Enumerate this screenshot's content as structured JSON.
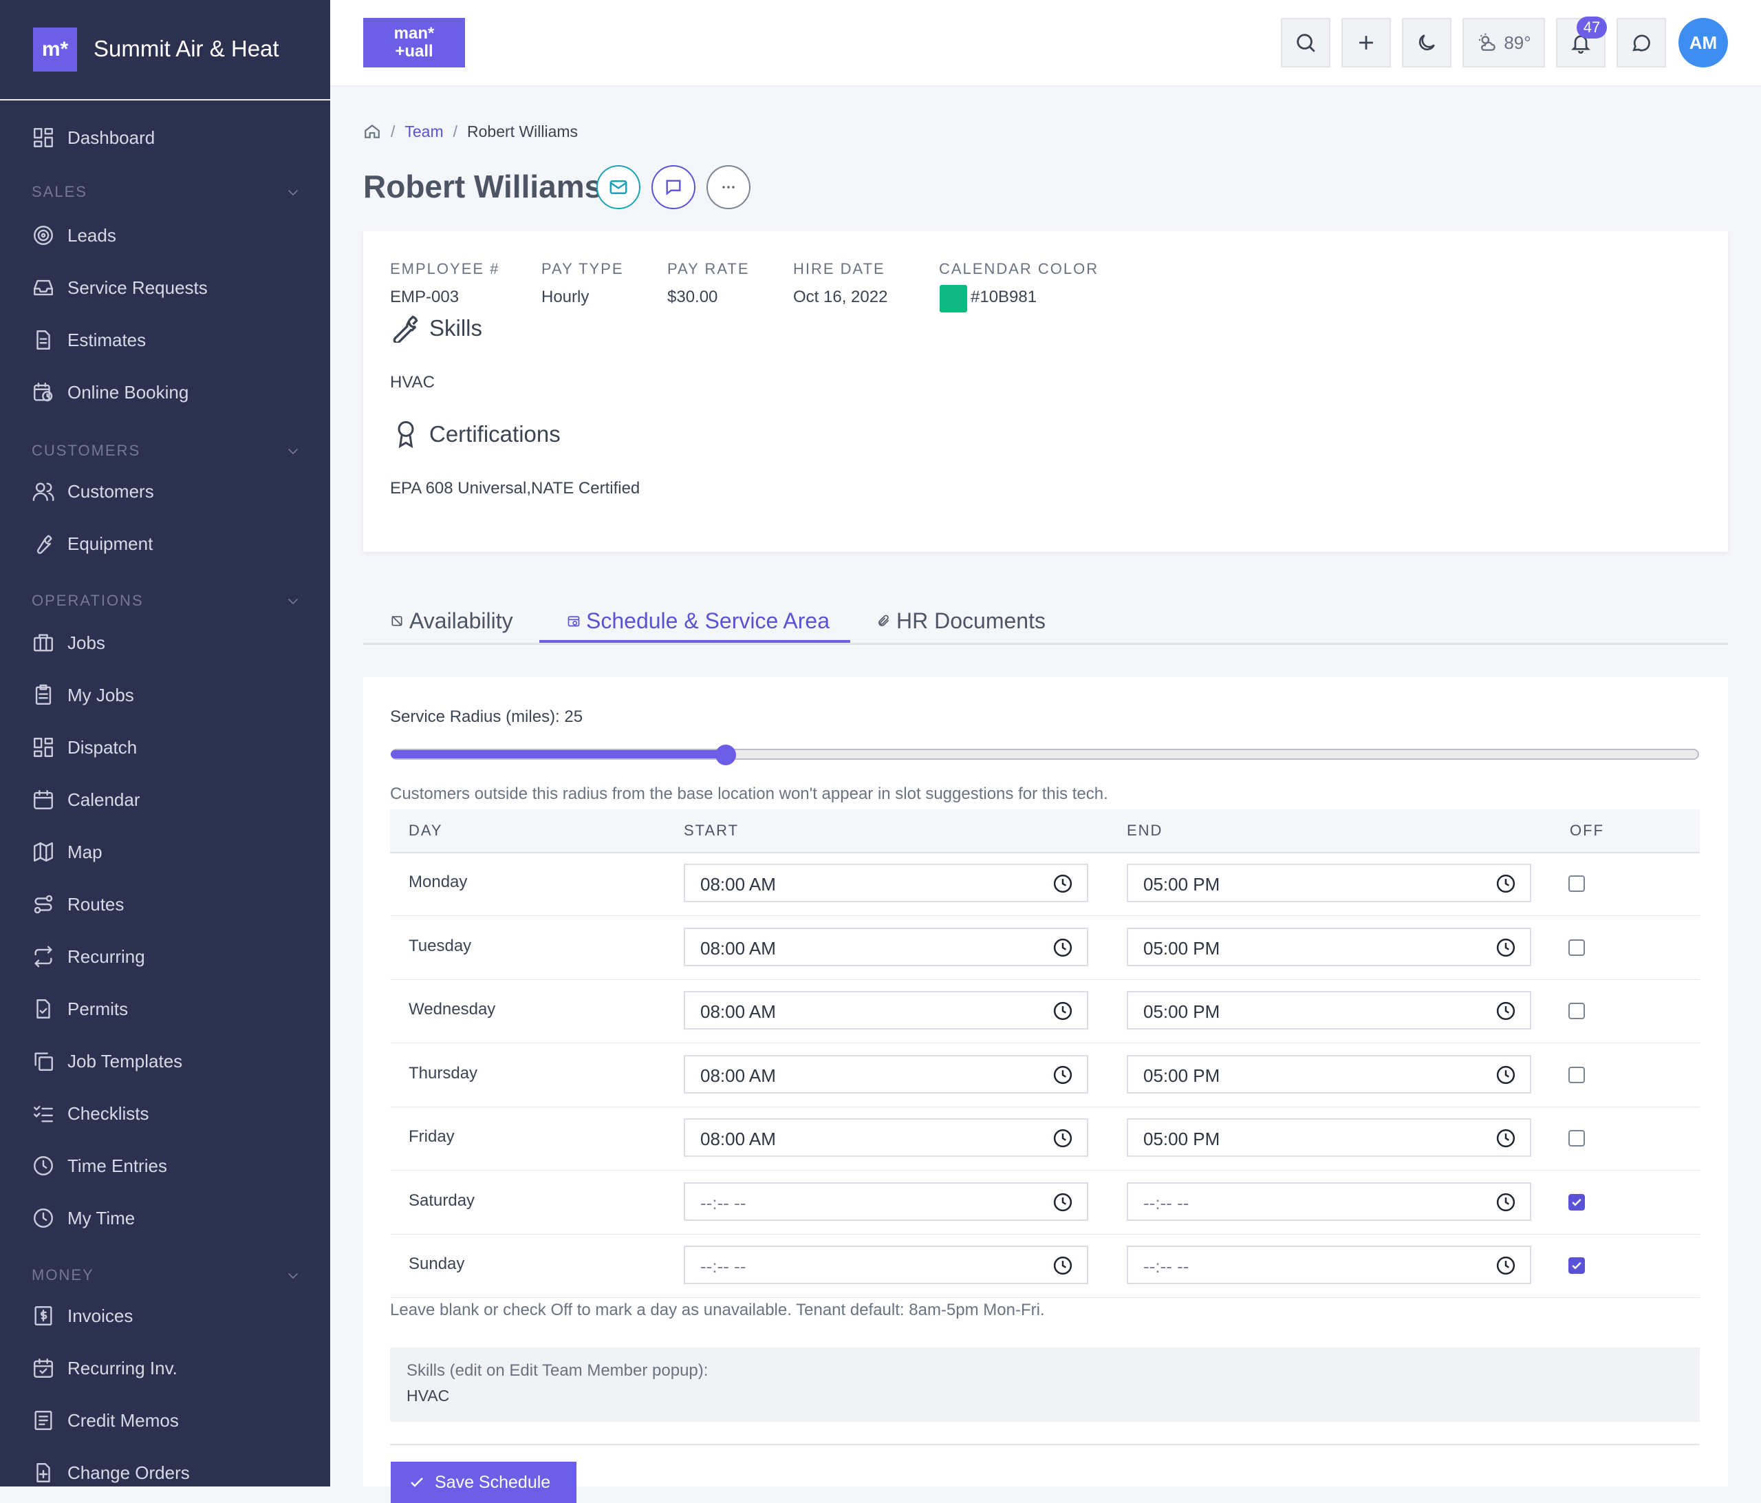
{
  "brand": {
    "logo_text": "m*",
    "name": "Summit Air & Heat"
  },
  "sidebar": {
    "items": [
      {
        "type": "item",
        "label": "Dashboard",
        "icon": "grid-icon"
      },
      {
        "type": "section",
        "label": "SALES"
      },
      {
        "type": "item",
        "label": "Leads",
        "icon": "target-icon"
      },
      {
        "type": "item",
        "label": "Service Requests",
        "icon": "inbox-icon"
      },
      {
        "type": "item",
        "label": "Estimates",
        "icon": "document-icon"
      },
      {
        "type": "item",
        "label": "Online Booking",
        "icon": "calendar-clock-icon"
      },
      {
        "type": "section",
        "label": "CUSTOMERS"
      },
      {
        "type": "item",
        "label": "Customers",
        "icon": "users-icon"
      },
      {
        "type": "item",
        "label": "Equipment",
        "icon": "wrench-icon"
      },
      {
        "type": "section",
        "label": "OPERATIONS"
      },
      {
        "type": "item",
        "label": "Jobs",
        "icon": "briefcase-icon"
      },
      {
        "type": "item",
        "label": "My Jobs",
        "icon": "clipboard-icon"
      },
      {
        "type": "item",
        "label": "Dispatch",
        "icon": "grid-icon"
      },
      {
        "type": "item",
        "label": "Calendar",
        "icon": "calendar-icon"
      },
      {
        "type": "item",
        "label": "Map",
        "icon": "map-icon"
      },
      {
        "type": "item",
        "label": "Routes",
        "icon": "route-icon"
      },
      {
        "type": "item",
        "label": "Recurring",
        "icon": "repeat-icon"
      },
      {
        "type": "item",
        "label": "Permits",
        "icon": "file-check-icon"
      },
      {
        "type": "item",
        "label": "Job Templates",
        "icon": "copy-icon"
      },
      {
        "type": "item",
        "label": "Checklists",
        "icon": "list-check-icon"
      },
      {
        "type": "item",
        "label": "Time Entries",
        "icon": "clock-icon"
      },
      {
        "type": "item",
        "label": "My Time",
        "icon": "clock-icon"
      },
      {
        "type": "section",
        "label": "MONEY"
      },
      {
        "type": "item",
        "label": "Invoices",
        "icon": "invoice-dollar-icon"
      },
      {
        "type": "item",
        "label": "Recurring Inv.",
        "icon": "calendar-check-icon"
      },
      {
        "type": "item",
        "label": "Credit Memos",
        "icon": "receipt-icon"
      },
      {
        "type": "item",
        "label": "Change Orders",
        "icon": "file-plus-icon"
      }
    ]
  },
  "topbar": {
    "app_logo_line1": "man*",
    "app_logo_line2": "+uall",
    "weather": "89°",
    "notifications_count": "47",
    "avatar_initials": "AM",
    "icons": [
      "search-icon",
      "plus-icon",
      "moon-icon",
      "weather-icon",
      "bell-icon",
      "chat-icon"
    ]
  },
  "breadcrumb": {
    "team": "Team",
    "current": "Robert Williams",
    "separator": "/"
  },
  "page_title": "Robert Williams",
  "profile": {
    "fields": [
      {
        "label": "EMPLOYEE #",
        "value": "EMP-003"
      },
      {
        "label": "PAY TYPE",
        "value": "Hourly"
      },
      {
        "label": "PAY RATE",
        "value": "$30.00"
      },
      {
        "label": "HIRE DATE",
        "value": "Oct 16, 2022"
      },
      {
        "label": "CALENDAR COLOR",
        "value": "#10B981"
      }
    ],
    "calendar_color": "#10B981",
    "skills_title": "Skills",
    "skills_value": "HVAC",
    "certs_title": "Certifications",
    "certs_value": "EPA 608 Universal,NATE Certified"
  },
  "tabs": [
    {
      "label": "Availability"
    },
    {
      "label": "Schedule & Service Area",
      "active": true
    },
    {
      "label": "HR Documents"
    }
  ],
  "schedule": {
    "radius_label": "Service Radius (miles): 25",
    "radius_value": 25,
    "radius_max": 100,
    "radius_help": "Customers outside this radius from the base location won't appear in slot suggestions for this tech.",
    "columns": {
      "day": "DAY",
      "start": "START",
      "end": "END",
      "off": "OFF"
    },
    "rows": [
      {
        "day": "Monday",
        "start": "08:00  AM",
        "end": "05:00  PM",
        "off": false
      },
      {
        "day": "Tuesday",
        "start": "08:00  AM",
        "end": "05:00  PM",
        "off": false
      },
      {
        "day": "Wednesday",
        "start": "08:00  AM",
        "end": "05:00  PM",
        "off": false
      },
      {
        "day": "Thursday",
        "start": "08:00  AM",
        "end": "05:00  PM",
        "off": false
      },
      {
        "day": "Friday",
        "start": "08:00  AM",
        "end": "05:00  PM",
        "off": false
      },
      {
        "day": "Saturday",
        "start": "--:-- --",
        "end": "--:-- --",
        "off": true
      },
      {
        "day": "Sunday",
        "start": "--:-- --",
        "end": "--:-- --",
        "off": true
      }
    ],
    "help": "Leave blank or check Off to mark a day as unavailable. Tenant default: 8am-5pm Mon-Fri.",
    "skills_box_title": "Skills (edit on Edit Team Member popup):",
    "skills_box_value": "HVAC",
    "save_label": "Save Schedule"
  },
  "colors": {
    "accent": "#6C5EE6",
    "sidebar": "#2D3150",
    "avatar": "#3D8EF0"
  }
}
